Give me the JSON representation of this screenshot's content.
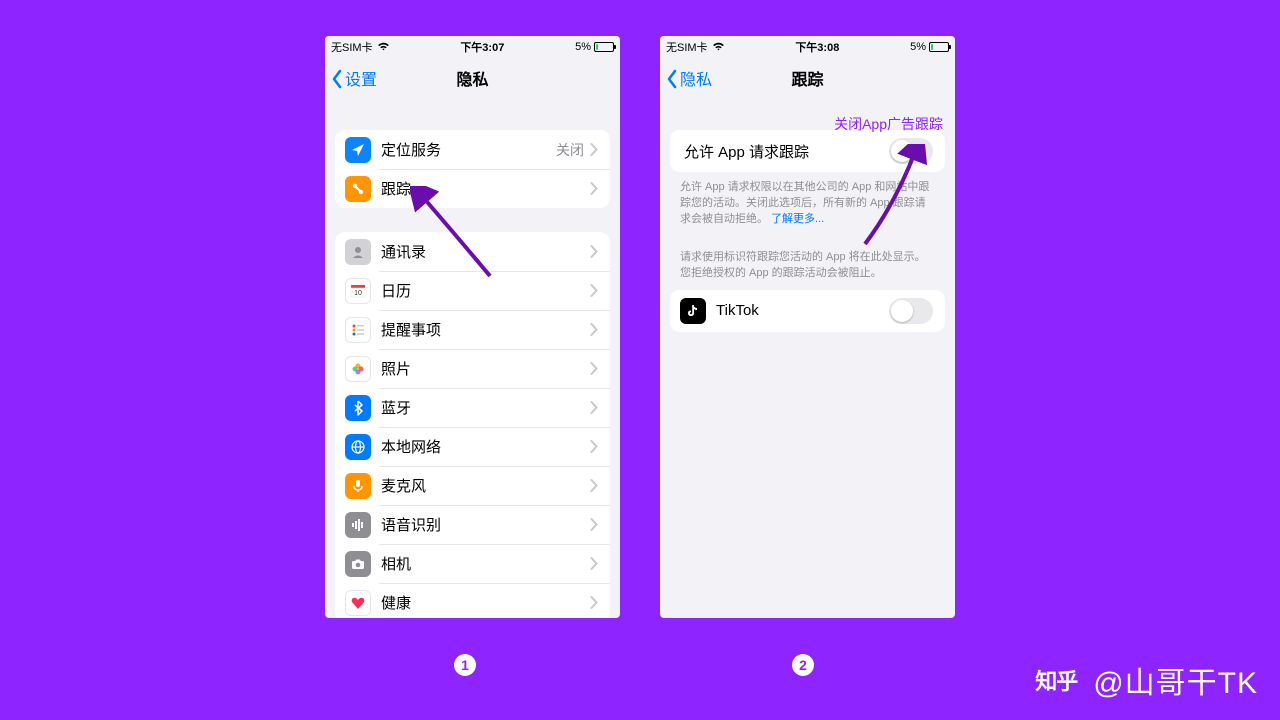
{
  "colors": {
    "accent_blue": "#007aff",
    "bg_purple": "#8e24ff",
    "ios_gray": "#8e8e93"
  },
  "left": {
    "status": {
      "carrier": "无SIM卡",
      "time": "下午3:07",
      "battery": "5%"
    },
    "nav": {
      "back": "设置",
      "title": "隐私"
    },
    "group1": [
      {
        "icon": "location-icon",
        "label": "定位服务",
        "detail": "关闭",
        "iconColor": "#0a84ff"
      },
      {
        "icon": "tracking-icon",
        "label": "跟踪",
        "detail": "",
        "iconColor": "#ff9500"
      }
    ],
    "group2": [
      {
        "icon": "contacts-icon",
        "label": "通讯录",
        "iconColor": "#d1d1d6"
      },
      {
        "icon": "calendar-icon",
        "label": "日历",
        "iconColor": "#ffffff"
      },
      {
        "icon": "reminders-icon",
        "label": "提醒事项",
        "iconColor": "#ffffff"
      },
      {
        "icon": "photos-icon",
        "label": "照片",
        "iconColor": "#ffffff"
      },
      {
        "icon": "bluetooth-icon",
        "label": "蓝牙",
        "iconColor": "#007aff"
      },
      {
        "icon": "localnetwork-icon",
        "label": "本地网络",
        "iconColor": "#007aff"
      },
      {
        "icon": "microphone-icon",
        "label": "麦克风",
        "iconColor": "#ff9500"
      },
      {
        "icon": "speech-icon",
        "label": "语音识别",
        "iconColor": "#8e8e93"
      },
      {
        "icon": "camera-icon",
        "label": "相机",
        "iconColor": "#8e8e93"
      },
      {
        "icon": "health-icon",
        "label": "健康",
        "iconColor": "#ffffff"
      }
    ]
  },
  "right": {
    "status": {
      "carrier": "无SIM卡",
      "time": "下午3:08",
      "battery": "5%"
    },
    "nav": {
      "back": "隐私",
      "title": "跟踪"
    },
    "annotation": "关闭App广告跟踪",
    "toggleRow": {
      "label": "允许 App 请求跟踪"
    },
    "footer1_pre": "允许 App 请求权限以在其他公司的 App 和网站中跟踪您的活动。关闭此选项后，所有新的 App 跟踪请求会被自动拒绝。",
    "footer1_link": "了解更多...",
    "footer2": "请求使用标识符跟踪您活动的 App 将在此处显示。您拒绝授权的 App 的跟踪活动会被阻止。",
    "appRow": {
      "label": "TikTok"
    }
  },
  "steps": {
    "one": "1",
    "two": "2"
  },
  "watermark": {
    "logo": "知乎",
    "handle": "@山哥干TK"
  }
}
